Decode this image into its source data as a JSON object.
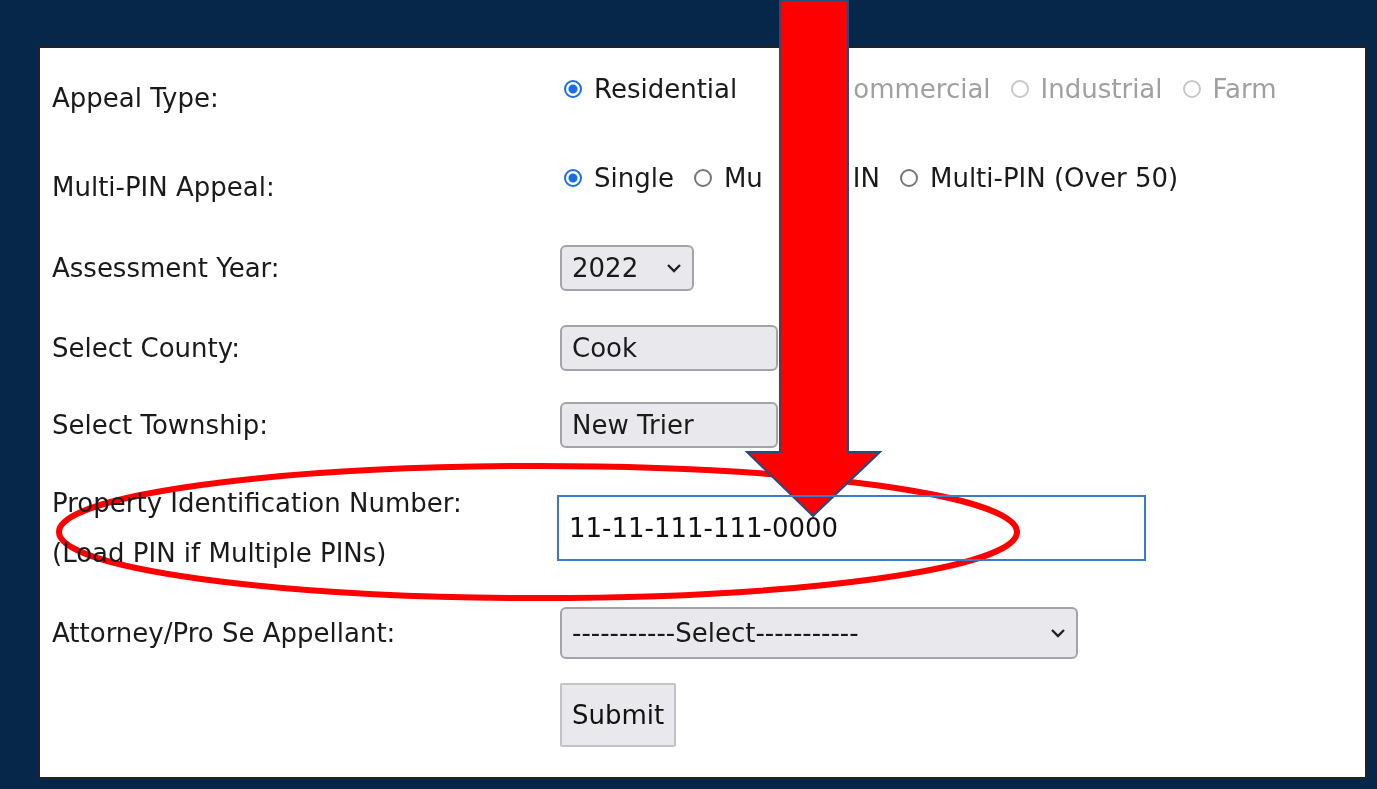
{
  "form": {
    "appeal_type": {
      "label": "Appeal Type:",
      "options": [
        {
          "label_parts": [
            "Residential"
          ],
          "selected": true,
          "disabled": false
        },
        {
          "label_parts": [
            "ommercial"
          ],
          "disabled": true
        },
        {
          "label_parts": [
            "Industrial"
          ],
          "selected": false,
          "disabled": true
        },
        {
          "label_parts": [
            "Farm"
          ],
          "selected": false,
          "disabled": true
        }
      ]
    },
    "multi_pin": {
      "label": "Multi-PIN Appeal:",
      "options": [
        {
          "label_parts": [
            "Single"
          ],
          "selected": true,
          "disabled": false
        },
        {
          "label_parts": [
            "Mu",
            "IN"
          ],
          "selected": false,
          "disabled": false
        },
        {
          "label_parts": [
            "Multi-PIN (Over 50)"
          ],
          "selected": false,
          "disabled": false
        }
      ]
    },
    "assessment_year": {
      "label": "Assessment Year:",
      "value": "2022"
    },
    "county": {
      "label": "Select County:",
      "value": "Cook"
    },
    "township": {
      "label": "Select Township:",
      "value": "New Trier"
    },
    "pin": {
      "label": "Property Identification Number:",
      "sublabel": "(Load PIN if Multiple PINs)",
      "value": "11-11-111-111-0000"
    },
    "attorney": {
      "label": "Attorney/Pro Se Appellant:",
      "value": "-----------Select-----------"
    },
    "submit": "Submit"
  }
}
